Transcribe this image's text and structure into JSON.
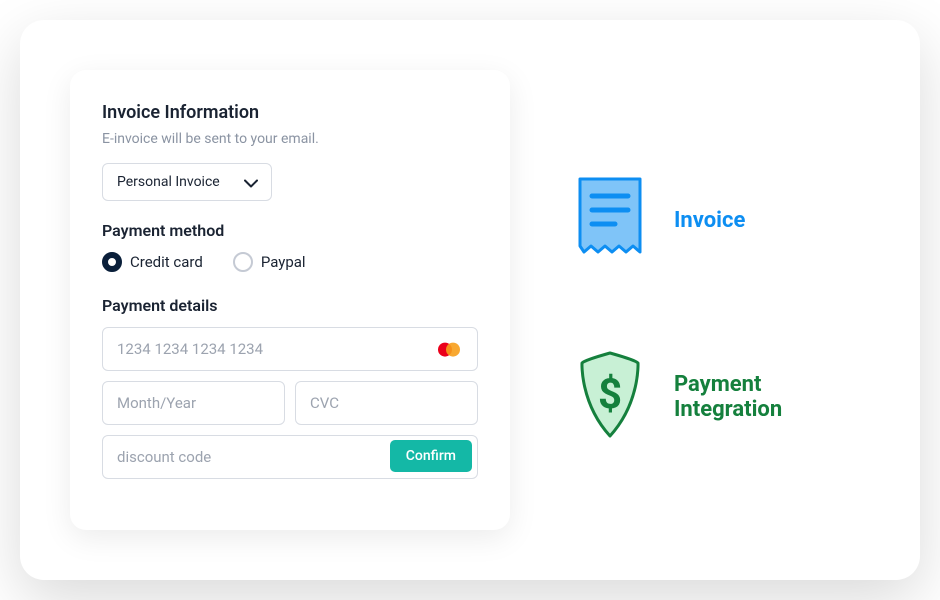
{
  "form": {
    "title": "Invoice Information",
    "subtitle": "E-invoice will be sent to your email.",
    "invoice_type": "Personal Invoice",
    "payment_method_title": "Payment method",
    "payment_methods": {
      "credit_card": "Credit card",
      "paypal": "Paypal"
    },
    "payment_details_title": "Payment details",
    "placeholders": {
      "card_number": "1234 1234 1234 1234",
      "expiry": "Month/Year",
      "cvc": "CVC",
      "discount": "discount code"
    },
    "confirm_label": "Confirm"
  },
  "features": {
    "invoice_label": "Invoice",
    "payment_label": "Payment Integration"
  }
}
